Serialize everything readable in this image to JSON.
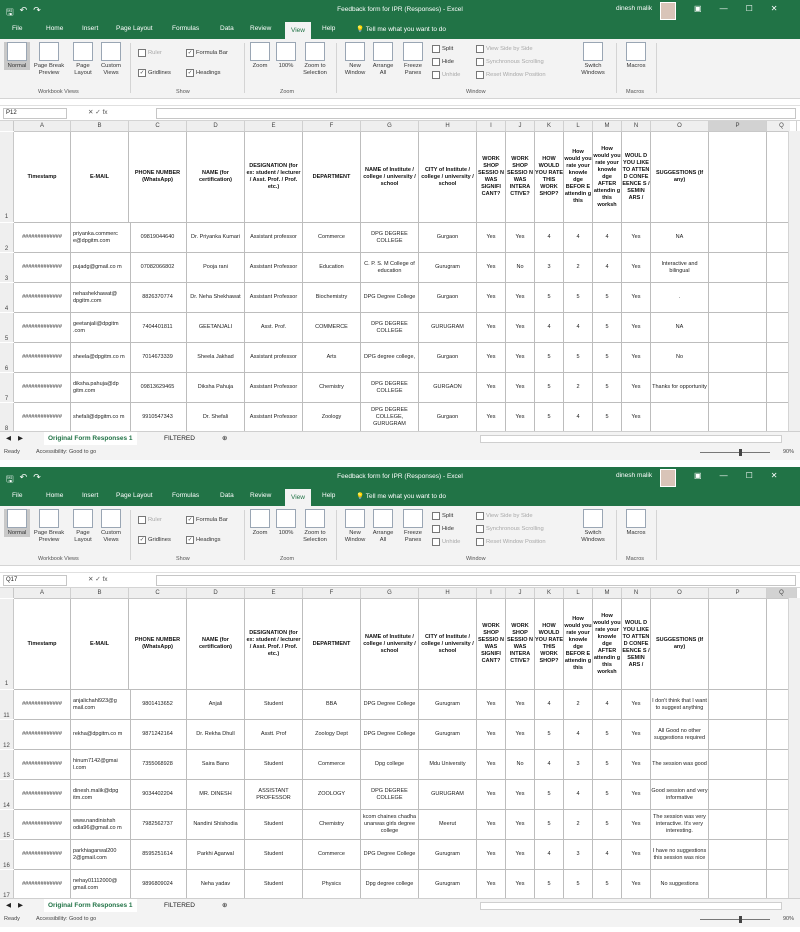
{
  "app": {
    "title": "Feedback form for IPR (Responses)  -  Excel",
    "user": "dinesh malik",
    "tabs": [
      "File",
      "Home",
      "Insert",
      "Page Layout",
      "Formulas",
      "Data",
      "Review",
      "View",
      "Help"
    ],
    "active_tab": "View",
    "tell_me": "Tell me what you want to do",
    "ribbon": {
      "workbook_views": [
        "Normal",
        "Page Break Preview",
        "Page Layout",
        "Custom Views"
      ],
      "show": {
        "ruler": "Ruler",
        "formula_bar": "Formula Bar",
        "gridlines": "Gridlines",
        "headings": "Headings"
      },
      "zoom": [
        "Zoom",
        "100%",
        "Zoom to Selection"
      ],
      "window": {
        "new_window": "New Window",
        "arrange_all": "Arrange All",
        "freeze_panes": "Freeze Panes",
        "split": "Split",
        "hide": "Hide",
        "unhide": "Unhide",
        "side_by_side": "View Side by Side",
        "sync_scroll": "Synchronous Scrolling",
        "reset_pos": "Reset Window Position",
        "switch": "Switch Windows"
      },
      "macros": "Macros",
      "groups": [
        "Workbook Views",
        "Show",
        "Zoom",
        "Window",
        "Macros"
      ]
    },
    "sheets": [
      "Original Form Responses 1",
      "FILTERED"
    ],
    "status": "Ready",
    "accessibility": "Accessibility: Good to go",
    "zoom_level": "90%"
  },
  "columns": [
    "A",
    "B",
    "C",
    "D",
    "E",
    "F",
    "G",
    "H",
    "I",
    "J",
    "K",
    "L",
    "M",
    "N",
    "O",
    "P",
    "Q"
  ],
  "headers": [
    "Timestamp",
    "E-MAIL",
    "PHONE NUMBER (WhatsApp)",
    "NAME (for certification)",
    "DESIGNATION (for ex: student / lecturer / Asst. Prof. / Prof. etc.)",
    "DEPARTMENT",
    "NAME of Institute / college / university / school",
    "CITY of Institute / college / university / school",
    "WORK SHOP SESSIO N WAS SIGNIFI CANT?",
    "WORK SHOP SESSIO N WAS INTERA CTIVE?",
    "HOW WOULD YOU RATE THIS WORK SHOP?",
    "How would you rate your knowle dge BEFOR E attendin g this",
    "How would you rate your knowle dge AFTER attendin g this worksh",
    "WOUL D YOU LIKE TO ATTEN D CONFE EENCE S / SEMIN ARS /",
    "SUGGESTIONS (If any)"
  ],
  "window1": {
    "name_box": "P12",
    "selected_col": "P",
    "rows": [
      {
        "n": "2",
        "cells": [
          "#############",
          "priyanka.commerc e@dpgitm.com",
          "09819044640",
          "Dr. Priyanka Kumari",
          "Assistant professor",
          "Commerce",
          "DPG DEGREE COLLEGE",
          "Gurgaon",
          "Yes",
          "Yes",
          "4",
          "4",
          "4",
          "Yes",
          "NA"
        ]
      },
      {
        "n": "3",
        "cells": [
          "#############",
          "pujadg@gmail.co m",
          "07082066802",
          "Pooja rani",
          "Assistant Professor",
          "Education",
          "C. P. S. M College of education",
          "Gurugram",
          "Yes",
          "No",
          "3",
          "2",
          "4",
          "Yes",
          "Interactive and bilingual"
        ]
      },
      {
        "n": "4",
        "cells": [
          "#############",
          "nehashekhawat@ dpgitm.com",
          "8826370774",
          "Dr. Neha Shekhawat",
          "Assistant Professor",
          "Biochemistry",
          "DPG Degree College",
          "Gurgaon",
          "Yes",
          "Yes",
          "5",
          "5",
          "5",
          "Yes",
          "."
        ]
      },
      {
        "n": "5",
        "cells": [
          "#############",
          "geetanjali@dpgitm .com",
          "7404401811",
          "GEETANJALI",
          "Asst. Prof.",
          "COMMERCE",
          "DPG DEGREE COLLEGE",
          "GURUGRAM",
          "Yes",
          "Yes",
          "4",
          "4",
          "5",
          "Yes",
          "NA"
        ]
      },
      {
        "n": "6",
        "cells": [
          "#############",
          "sheela@dpgitm.co m",
          "7014673339",
          "Sheela Jakhad",
          "Assistant professor",
          "Arts",
          "DPG degree college,",
          "Gurgaon",
          "Yes",
          "Yes",
          "5",
          "5",
          "5",
          "Yes",
          "No"
        ]
      },
      {
        "n": "7",
        "cells": [
          "#############",
          "diksha.pahuja@dp gitm.com",
          "09813629465",
          "Diksha Pahuja",
          "Assistant Professor",
          "Chemistry",
          "DPG DEGREE COLLEGE",
          "GURGAON",
          "Yes",
          "Yes",
          "5",
          "2",
          "5",
          "Yes",
          "Thanks for opportunity"
        ]
      },
      {
        "n": "8",
        "cells": [
          "#############",
          "shefali@dpgitm.co m",
          "9910547343",
          "Dr. Shefali",
          "Assistant Professor",
          "Zoology",
          "DPG DEGREE COLLEGE, GURUGRAM",
          "Gurgaon",
          "Yes",
          "Yes",
          "5",
          "4",
          "5",
          "Yes",
          ""
        ]
      }
    ]
  },
  "window2": {
    "name_box": "Q17",
    "selected_col": "Q",
    "rows": [
      {
        "n": "11",
        "cells": [
          "#############",
          "anjalichahl923@g mail.com",
          "9801413652",
          "Anjali",
          "Student",
          "BBA",
          "DPG Degree College",
          "Gurugram",
          "Yes",
          "Yes",
          "4",
          "2",
          "4",
          "Yes",
          "I don't think that I want to suggest anything"
        ]
      },
      {
        "n": "12",
        "cells": [
          "#############",
          "rekha@dpgitm.co m",
          "9871242164",
          "Dr. Rekha Dhull",
          "Asstt. Prof",
          "Zoology Dept",
          "DPG Degree College",
          "Gurugram",
          "Yes",
          "Yes",
          "5",
          "4",
          "5",
          "Yes",
          "All Good no other suggestions required"
        ]
      },
      {
        "n": "13",
        "cells": [
          "#############",
          "hinum7142@gmai l.com",
          "7355068928",
          "Saira Bano",
          "Student",
          "Commerce",
          "Dpg college",
          "Mdu University",
          "Yes",
          "No",
          "4",
          "3",
          "5",
          "Yes",
          "The session was good"
        ]
      },
      {
        "n": "14",
        "cells": [
          "#############",
          "dinesh.malik@dpg itm.com",
          "9034402204",
          "MR. DINESH",
          "ASSISTANT PROFESSOR",
          "ZOOLOGY",
          "DPG DEGREE COLLEGE",
          "GURUGRAM",
          "Yes",
          "Yes",
          "5",
          "4",
          "5",
          "Yes",
          "Good session and very informative"
        ]
      },
      {
        "n": "15",
        "cells": [
          "#############",
          "www.nandinishsh odia96@gmail.co m",
          "7982562737",
          "Nandini Shishodia",
          "Student",
          "Chemistry",
          "kcom chaines chadha unarwas girls degree college",
          "Meerut",
          "Yes",
          "Yes",
          "5",
          "2",
          "5",
          "Yes",
          "The session was very interactive. It's very interesting."
        ]
      },
      {
        "n": "16",
        "cells": [
          "#############",
          "parkhiagarwal200 2@gmail.com",
          "8595251614",
          "Parkhi Agarwal",
          "Student",
          "Commerce",
          "DPG Degree College",
          "Gurugram",
          "Yes",
          "Yes",
          "4",
          "3",
          "4",
          "Yes",
          "I have no suggestions this session was nice"
        ]
      },
      {
        "n": "17",
        "cells": [
          "#############",
          "nehay01112000@ gmail.com",
          "9896809024",
          "Neha yadav",
          "Student",
          "Physics",
          "Dpg degree college",
          "Gurugram",
          "Yes",
          "Yes",
          "5",
          "5",
          "5",
          "Yes",
          "No suggestions"
        ]
      }
    ]
  },
  "colors": {
    "excel_green": "#217346"
  }
}
